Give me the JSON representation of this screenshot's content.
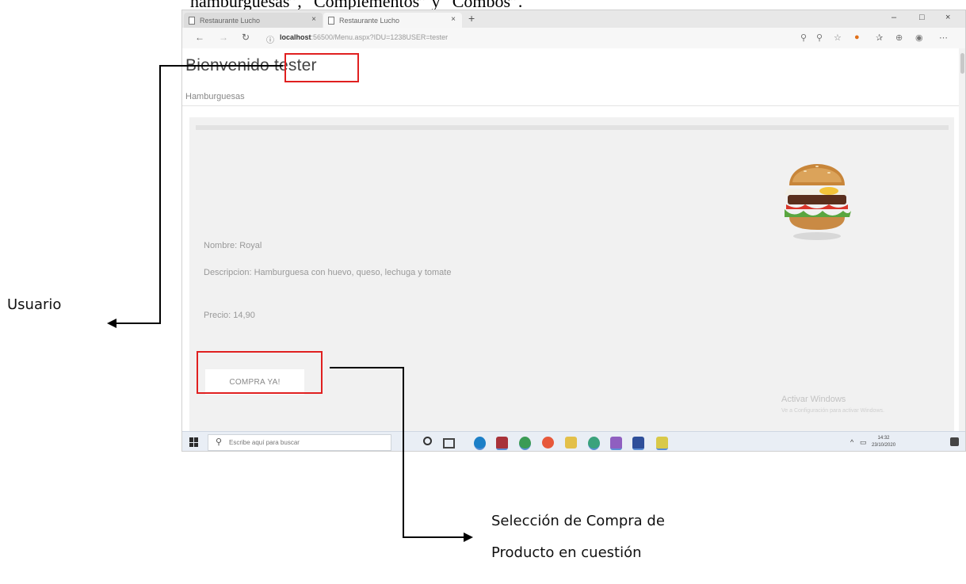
{
  "document": {
    "top_text": "hamburguesas”, “Complementos” y “Combos”."
  },
  "browser": {
    "tabs": [
      {
        "label": "Restaurante Lucho",
        "active": false
      },
      {
        "label": "Restaurante Lucho",
        "active": true
      }
    ],
    "new_tab": "+",
    "url_host": "localhost",
    "url_rest": ":56500/Menu.aspx?IDU=1238USER=tester",
    "window_controls": [
      "–",
      "□",
      "×"
    ],
    "nav": {
      "back": "←",
      "forward": "→",
      "refresh": "↻",
      "info": "ⓘ"
    }
  },
  "page": {
    "welcome_word": "Bienvenido",
    "username": "tester",
    "category": "Hamburguesas",
    "product": {
      "name": "Nombre: Royal",
      "description": "Descripcion: Hamburguesa con huevo, queso, lechuga y tomate",
      "price": "Precio: 14,90",
      "buy_label": "COMPRA YA!"
    },
    "activation": {
      "title": "Activar Windows",
      "subtitle": "Ve a Configuración para activar Windows."
    }
  },
  "taskbar": {
    "search_placeholder": "Escribe aquí para buscar",
    "time": "14:32",
    "date": "23/10/2020"
  },
  "annotations": {
    "user_label": "Usuario",
    "buy_label_line1": "Selección de Compra de",
    "buy_label_line2": "Producto en cuestión"
  },
  "colors": {
    "highlight": "#e02020",
    "page_bg": "#f1f1f1"
  }
}
